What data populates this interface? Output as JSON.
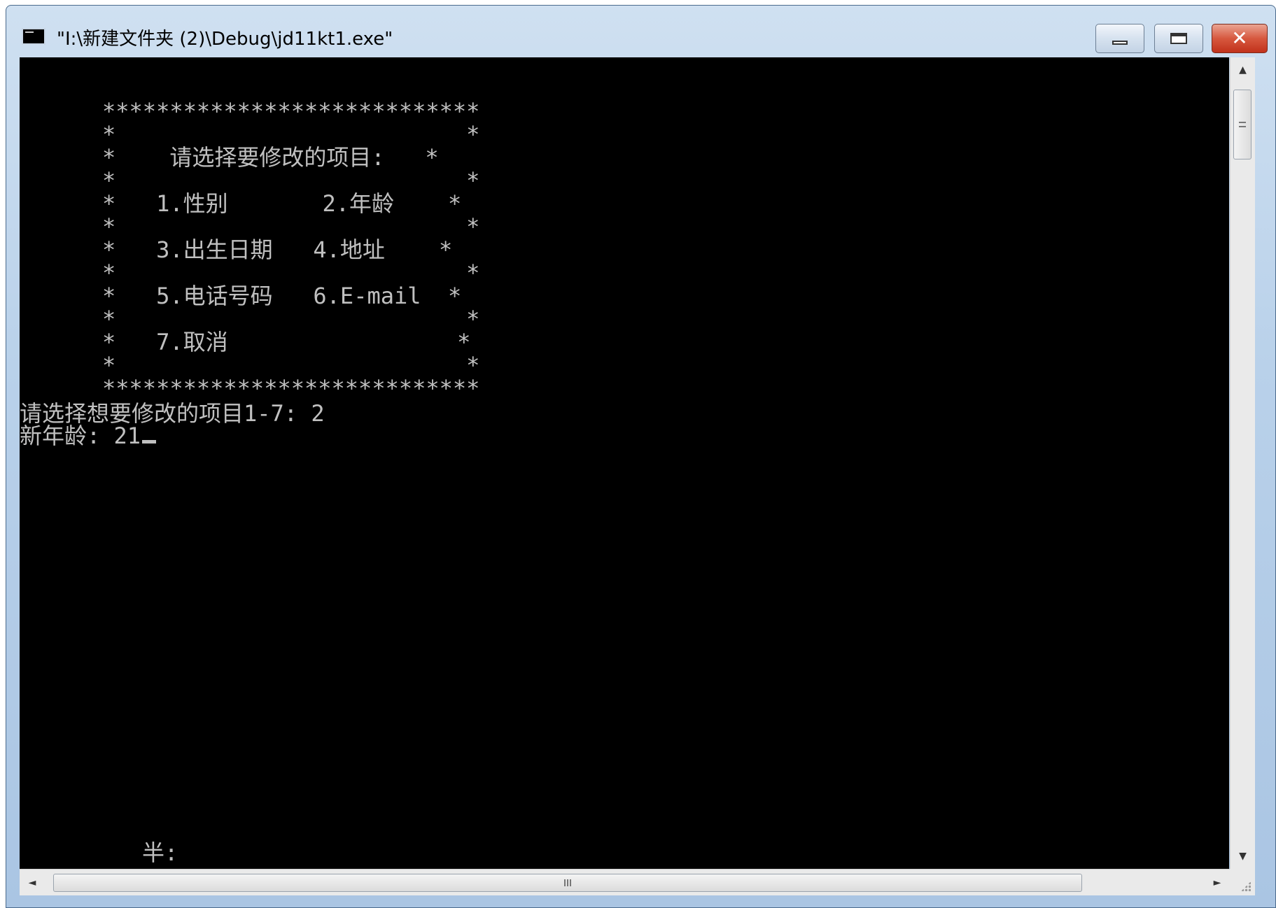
{
  "window": {
    "title": "\"I:\\新建文件夹 (2)\\Debug\\jd11kt1.exe\"",
    "close_symbol": "✕"
  },
  "console": {
    "box_lines": [
      "****************************",
      "*                          *",
      "*    请选择要修改的项目:   *",
      "*                          *",
      "*   1.性别       2.年龄    *",
      "*                          *",
      "*   3.出生日期   4.地址    *",
      "*                          *",
      "*   5.电话号码   6.E-mail  *",
      "*                          *",
      "*   7.取消                 *",
      "*                          *",
      "****************************"
    ],
    "prompt_line": "请选择想要修改的项目1-7: 2",
    "input_line": "新年龄: 21",
    "ime_status": "半:"
  },
  "icons": {
    "app": "console-app-icon",
    "minimize": "minimize-icon",
    "maximize": "maximize-icon",
    "close": "close-icon",
    "scroll_up": "arrow-up-icon",
    "scroll_down": "arrow-down-icon",
    "scroll_left": "arrow-left-icon",
    "scroll_right": "arrow-right-icon"
  },
  "colors": {
    "console_bg": "#000000",
    "console_fg": "#c0c0c0",
    "close_button": "#c9402a"
  }
}
